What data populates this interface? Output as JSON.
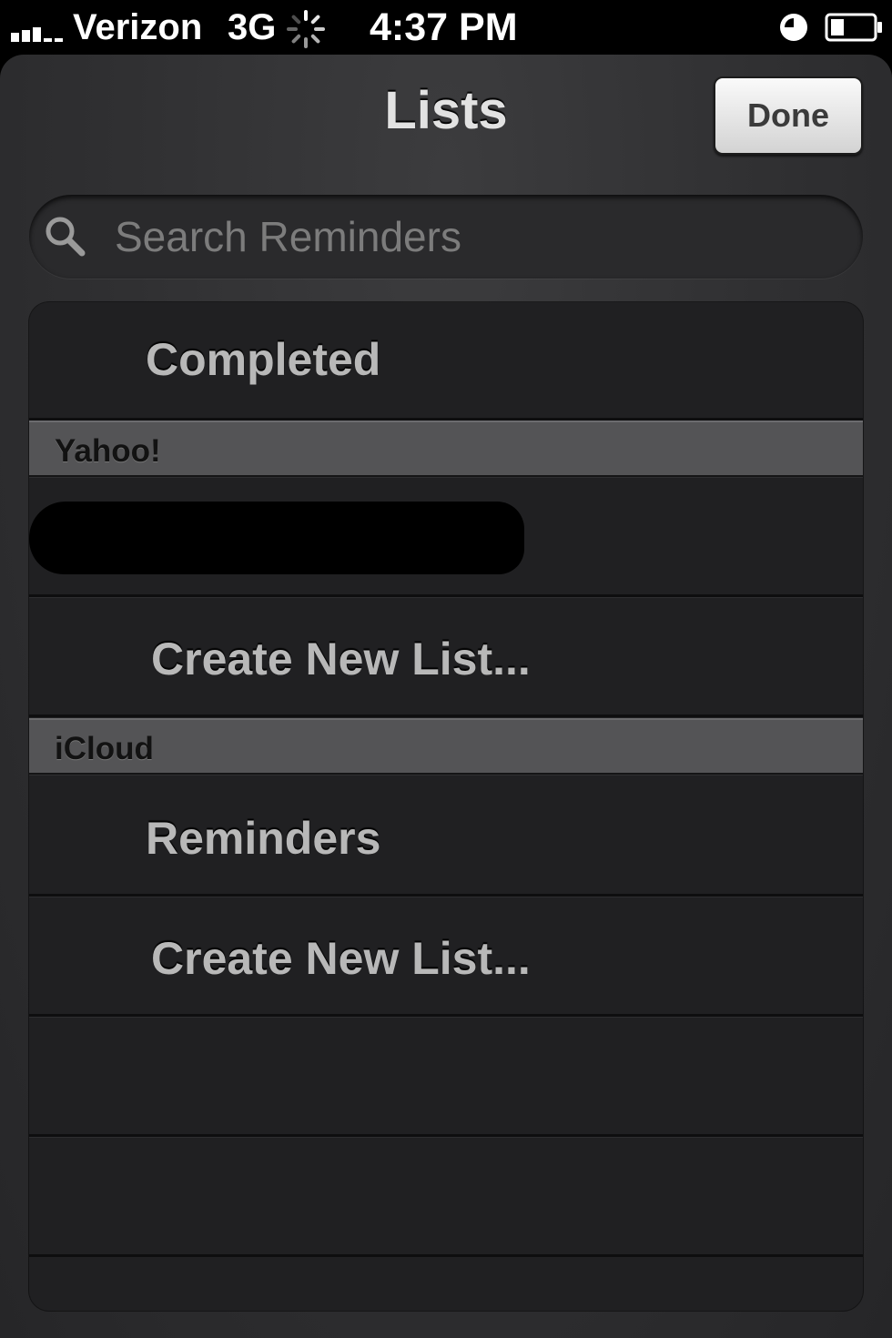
{
  "status_bar": {
    "carrier": "Verizon",
    "network": "3G",
    "time": "4:37 PM",
    "icons": [
      "signal-icon",
      "activity-spinner-icon",
      "clock-icon",
      "battery-icon"
    ]
  },
  "nav": {
    "title": "Lists",
    "done_label": "Done"
  },
  "search": {
    "placeholder": "Search Reminders"
  },
  "list": {
    "completed_label": "Completed",
    "sections": [
      {
        "header": "Yahoo!",
        "items": [
          "",
          "Create New List..."
        ]
      },
      {
        "header": "iCloud",
        "items": [
          "Reminders",
          "Create New List..."
        ]
      }
    ]
  },
  "colors": {
    "panel": "#2f2f31",
    "section_header": "#545456",
    "done_button": "#e6e6e6",
    "row_text": "#b8b8b8"
  }
}
